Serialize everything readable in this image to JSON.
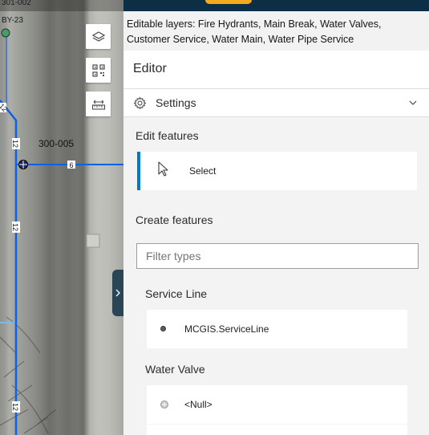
{
  "map": {
    "labels": {
      "top_left_1": "301-002",
      "top_left_2": "BY-23",
      "hydrant_id": "300-005",
      "pipe_size_a": "12",
      "pipe_size_b": "12",
      "pipe_size_c": "12",
      "pipe_size_d": "12",
      "pipe_size_e": "6",
      "pipe_size_f": "12"
    },
    "buttons": [
      {
        "name": "layers",
        "icon": "layers-icon"
      },
      {
        "name": "qr",
        "icon": "qr-code-icon"
      },
      {
        "name": "measure",
        "icon": "measure-icon"
      }
    ],
    "colors": {
      "pipe": "#1060e6",
      "hydrant_marker": "#1d2a5a",
      "point_marker": "#4b9b6a"
    }
  },
  "panel": {
    "editable_layers_text": "Editable layers: Fire Hydrants, Main Break, Water Valves, Customer Service, Water Main, Water Pipe Service",
    "editor_title": "Editor",
    "settings_label": "Settings",
    "edit_features_title": "Edit features",
    "select_label": "Select",
    "create_features_title": "Create features",
    "filter_placeholder": "Filter types",
    "groups": [
      {
        "title": "Service Line",
        "items": [
          {
            "label": "MCGIS.ServiceLine"
          }
        ]
      },
      {
        "title": "Water Valve",
        "items": [
          {
            "label": "<Null>"
          }
        ]
      }
    ],
    "colors": {
      "accent": "#007ac2",
      "header_bar": "#0c2f45",
      "header_accent": "#f5a91c"
    }
  }
}
